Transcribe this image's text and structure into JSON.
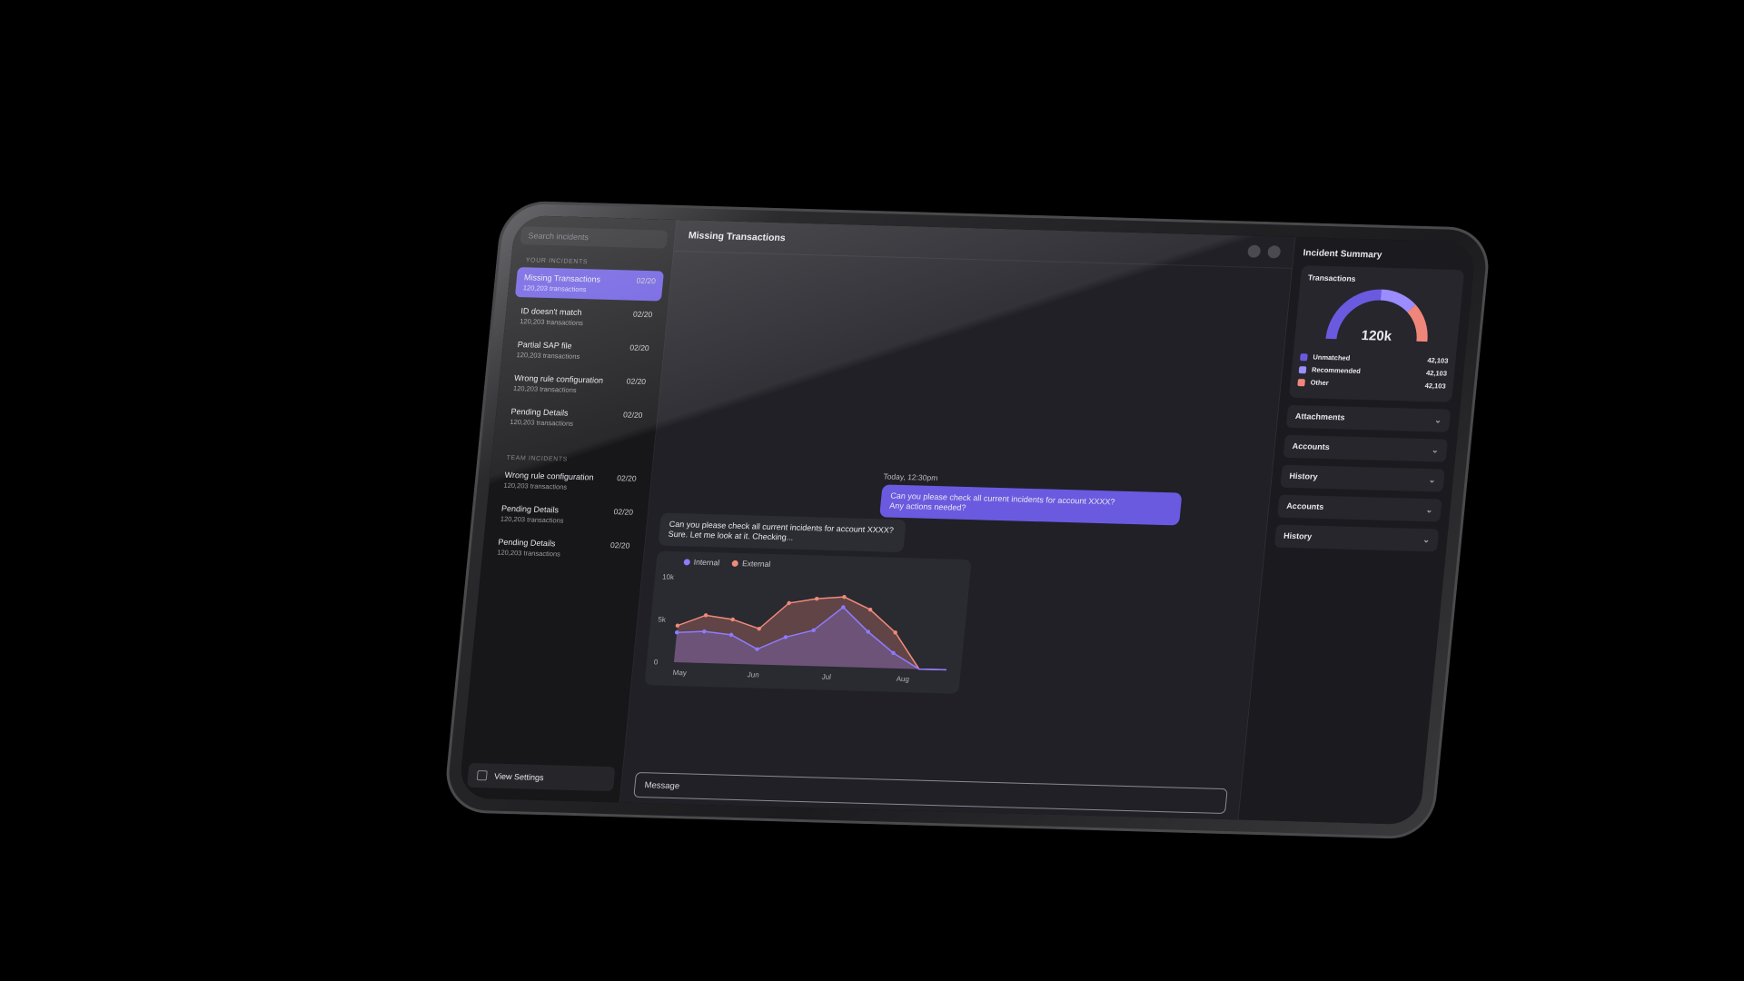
{
  "sidebar": {
    "search_placeholder": "Search incidents",
    "your_label": "YOUR INCIDENTS",
    "your_items": [
      {
        "title": "Missing Transactions",
        "sub": "120,203 transactions",
        "date": "02/20",
        "active": true
      },
      {
        "title": "ID doesn't match",
        "sub": "120,203 transactions",
        "date": "02/20"
      },
      {
        "title": "Partial SAP file",
        "sub": "120,203 transactions",
        "date": "02/20"
      },
      {
        "title": "Wrong rule configuration",
        "sub": "120,203 transactions",
        "date": "02/20"
      },
      {
        "title": "Pending Details",
        "sub": "120,203 transactions",
        "date": "02/20"
      }
    ],
    "team_label": "TEAM INCIDENTS",
    "team_items": [
      {
        "title": "Wrong rule configuration",
        "sub": "120,203 transactions",
        "date": "02/20"
      },
      {
        "title": "Pending Details",
        "sub": "120,203 transactions",
        "date": "02/20"
      },
      {
        "title": "Pending Details",
        "sub": "120,203 transactions",
        "date": "02/20"
      }
    ],
    "settings_label": "View Settings"
  },
  "main": {
    "title": "Missing Transactions",
    "timestamp": "Today, 12:30pm",
    "user_message_line1": "Can you please check all current incidents for account XXXX?",
    "user_message_line2": "Any actions needed?",
    "bot_message_line1": "Can you please check all current incidents for account XXXX?",
    "bot_message_line2": "Sure. Let me look at it. Checking...",
    "message_placeholder": "Message"
  },
  "chart_data": {
    "type": "area",
    "x": [
      0,
      1,
      2,
      3,
      4,
      5,
      6,
      7,
      8,
      9,
      10
    ],
    "xticks": [
      "May",
      "Jun",
      "Jul",
      "Aug"
    ],
    "yticks": [
      "0",
      "5k",
      "10k"
    ],
    "ylim": [
      0,
      10000
    ],
    "series": [
      {
        "name": "Internal",
        "color": "#8d7bff",
        "values": [
          3500,
          3700,
          3400,
          1800,
          3300,
          4200,
          7000,
          4200,
          1800,
          0,
          0
        ]
      },
      {
        "name": "External",
        "color": "#f08a7a",
        "values": [
          4300,
          5600,
          5200,
          4200,
          7300,
          7900,
          8200,
          6800,
          4200,
          0,
          0
        ]
      }
    ]
  },
  "summary": {
    "title": "Incident Summary",
    "card_title": "Transactions",
    "gauge_value": "120k",
    "legend": [
      {
        "name": "Unmatched",
        "value": "42,103",
        "color": "#6a5ae0"
      },
      {
        "name": "Recommended",
        "value": "42,103",
        "color": "#9b8cff"
      },
      {
        "name": "Other",
        "value": "42,103",
        "color": "#f0867a"
      }
    ],
    "sections": [
      "Attachments",
      "Accounts",
      "History",
      "Accounts",
      "History"
    ]
  }
}
